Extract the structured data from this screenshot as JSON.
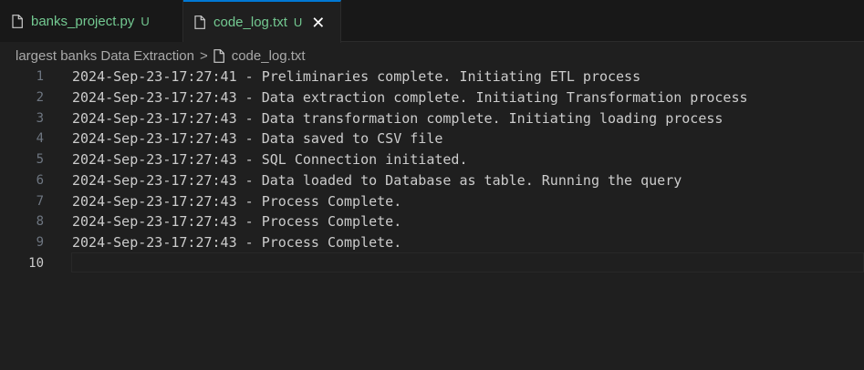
{
  "tabs": [
    {
      "label": "banks_project.py",
      "status": "U",
      "active": false
    },
    {
      "label": "code_log.txt",
      "status": "U",
      "active": true,
      "close": "✕"
    }
  ],
  "breadcrumb": {
    "folder": "largest banks Data Extraction",
    "separator": ">",
    "file": "code_log.txt"
  },
  "editor": {
    "current_line": 10,
    "lines": [
      {
        "number": "1",
        "text": "2024-Sep-23-17:27:41 - Preliminaries complete. Initiating ETL process"
      },
      {
        "number": "2",
        "text": "2024-Sep-23-17:27:43 - Data extraction complete. Initiating Transformation process"
      },
      {
        "number": "3",
        "text": "2024-Sep-23-17:27:43 - Data transformation complete. Initiating loading process"
      },
      {
        "number": "4",
        "text": "2024-Sep-23-17:27:43 - Data saved to CSV file"
      },
      {
        "number": "5",
        "text": "2024-Sep-23-17:27:43 - SQL Connection initiated."
      },
      {
        "number": "6",
        "text": "2024-Sep-23-17:27:43 - Data loaded to Database as table. Running the query"
      },
      {
        "number": "7",
        "text": "2024-Sep-23-17:27:43 - Process Complete."
      },
      {
        "number": "8",
        "text": "2024-Sep-23-17:27:43 - Process Complete."
      },
      {
        "number": "9",
        "text": "2024-Sep-23-17:27:43 - Process Complete."
      },
      {
        "number": "10",
        "text": ""
      }
    ]
  },
  "colors": {
    "accent": "#0078d4",
    "untracked": "#73c991",
    "background": "#1f1f1f"
  }
}
